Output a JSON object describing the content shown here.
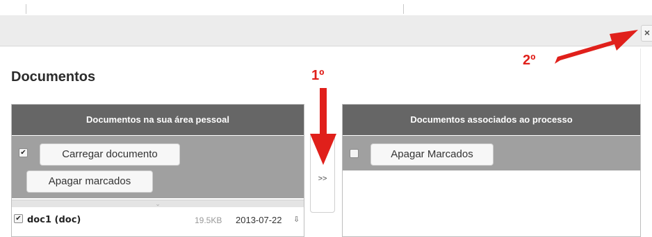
{
  "dialog": {
    "close_label": "×"
  },
  "page": {
    "title": "Documentos"
  },
  "left_panel": {
    "title": "Documentos na sua área pessoal",
    "upload_label": "Carregar documento",
    "delete_label": "Apagar marcados",
    "select_all_checked": "✔",
    "expand_glyph": "⌄",
    "documents": [
      {
        "check": "✔",
        "name": "doc1 (doc)",
        "size": "19.5KB",
        "date": "2013-07-22",
        "icon": "download-icon"
      }
    ]
  },
  "transfer": {
    "label": ">>"
  },
  "right_panel": {
    "title": "Documentos associados ao processo",
    "delete_label": "Apagar Marcados"
  },
  "annotations": {
    "step1": "1º",
    "step2": "2º",
    "color": "#e0201b"
  }
}
